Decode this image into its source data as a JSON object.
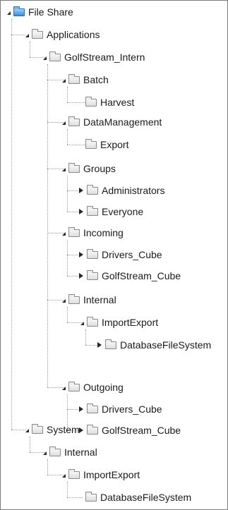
{
  "tree": {
    "root": "File Share",
    "applications": "Applications",
    "golfstream_intern": "GolfStream_Intern",
    "batch": "Batch",
    "harvest": "Harvest",
    "data_management": "DataManagement",
    "export": "Export",
    "groups": "Groups",
    "administrators": "Administrators",
    "everyone": "Everyone",
    "incoming": "Incoming",
    "incoming_drivers_cube": "Drivers_Cube",
    "incoming_golfstream_cube": "GolfStream_Cube",
    "internal": "Internal",
    "internal_import_export": "ImportExport",
    "internal_database_file_system": "DatabaseFileSystem",
    "outgoing": "Outgoing",
    "outgoing_drivers_cube": "Drivers_Cube",
    "outgoing_golfstream_cube": "GolfStream_Cube",
    "system": "System",
    "system_internal": "Internal",
    "system_import_export": "ImportExport",
    "system_database_file_system": "DatabaseFileSystem"
  }
}
